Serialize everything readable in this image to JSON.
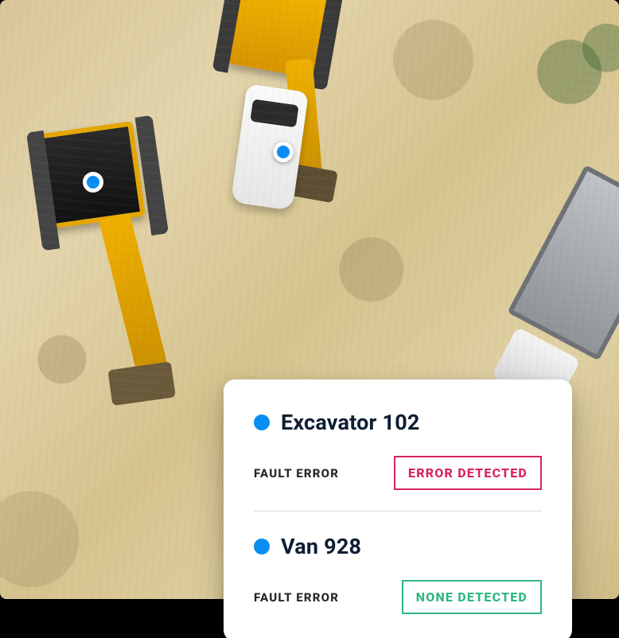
{
  "colors": {
    "accent": "#0a8df2",
    "error": "#d6245f",
    "ok": "#2fb783"
  },
  "markers": [
    {
      "id": "excavator-102"
    },
    {
      "id": "van-928"
    }
  ],
  "card": {
    "entries": [
      {
        "title": "Excavator 102",
        "label": "FAULT ERROR",
        "badge": "ERROR DETECTED",
        "status": "error"
      },
      {
        "title": "Van 928",
        "label": "FAULT ERROR",
        "badge": "NONE DETECTED",
        "status": "ok"
      }
    ]
  }
}
